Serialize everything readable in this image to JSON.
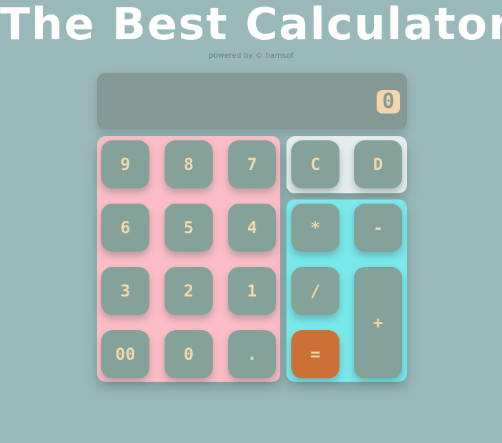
{
  "header": {
    "title": "The Best Calculator",
    "powered_by": "powered by © hamsof"
  },
  "display": {
    "value": "0"
  },
  "number_keys": [
    "9",
    "8",
    "7",
    "6",
    "5",
    "4",
    "3",
    "2",
    "1",
    "00",
    "0",
    "."
  ],
  "clear_keys": {
    "clear": "C",
    "delete": "D"
  },
  "operator_keys": {
    "multiply": "*",
    "subtract": "-",
    "divide": "/",
    "add": "+",
    "equals": "="
  },
  "colors": {
    "background": "#99b8b9",
    "display": "#849896",
    "number_panel": "#fcbcc6",
    "clear_panel": "#e4ecec",
    "operator_panel": "#78e8ea",
    "key": "#84a29a",
    "key_text": "#f3d9a8",
    "equals_key": "#cc7136"
  }
}
